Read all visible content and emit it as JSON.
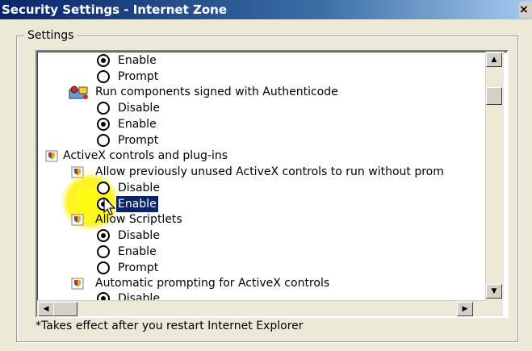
{
  "window": {
    "title": "Security Settings - Internet Zone",
    "close_glyph": "×"
  },
  "settings": {
    "group_label": "Settings",
    "footnote": "*Takes effect after you restart Internet Explorer"
  },
  "list": {
    "options": {
      "opt1": "Enable",
      "opt2": "Prompt",
      "item1": "Run components signed with Authenticode",
      "opt3": "Disable",
      "opt4": "Enable",
      "opt5": "Prompt",
      "cat1": "ActiveX controls and plug-ins",
      "item2": "Allow previously unused ActiveX controls to run without prom",
      "opt6": "Disable",
      "opt7": "Enable",
      "item3": "Allow Scriptlets",
      "opt8": "Disable",
      "opt9": "Enable",
      "opt10": "Prompt",
      "item4": "Automatic prompting for ActiveX controls",
      "opt11": "Disable"
    },
    "selected_option": "Enable"
  },
  "scrollbars": {
    "up_glyph": "▲",
    "down_glyph": "▼",
    "left_glyph": "◀",
    "right_glyph": "▶"
  },
  "icons": {
    "cert": "certificate-icon",
    "activex": "activex-settings-icon"
  }
}
